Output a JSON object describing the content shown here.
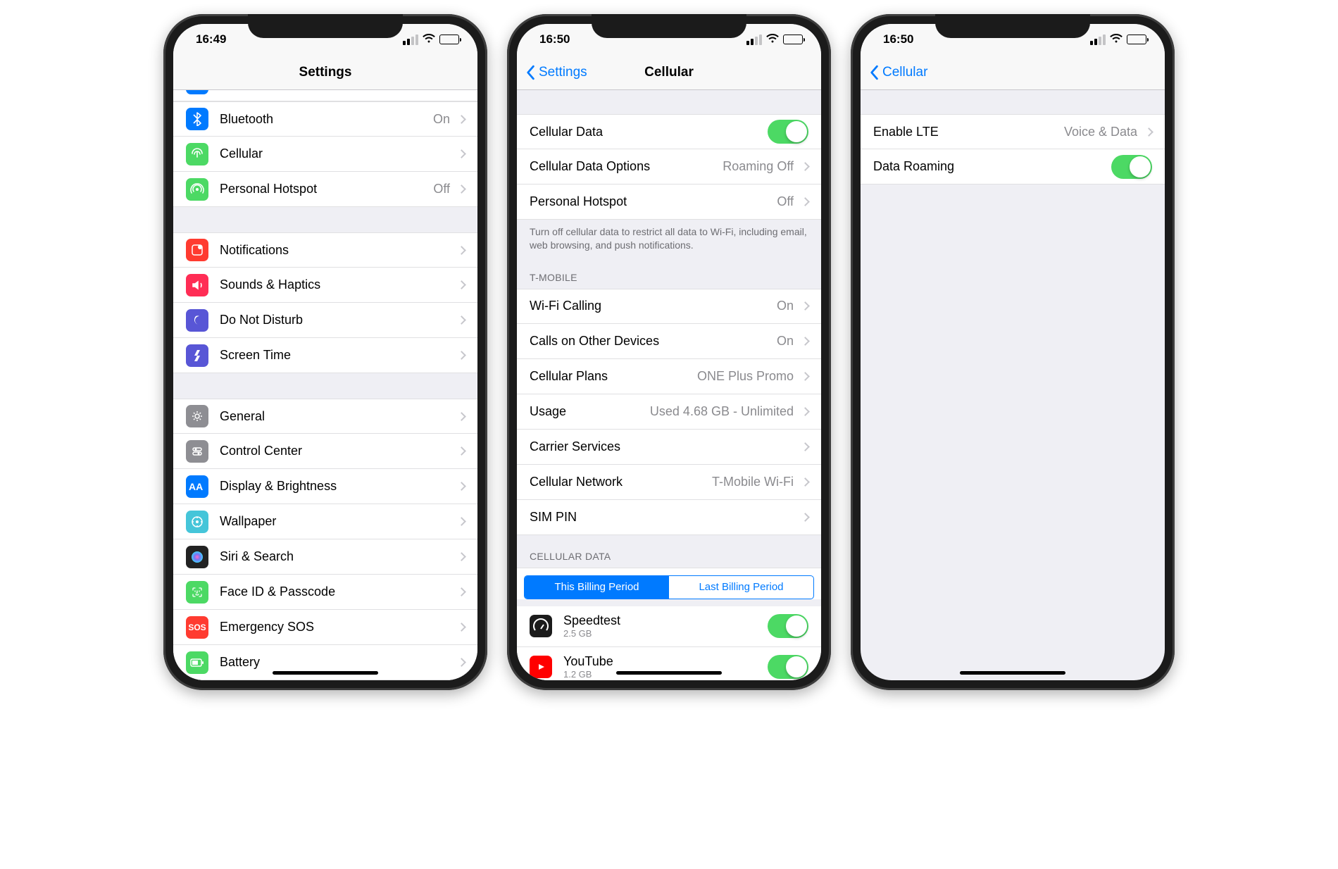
{
  "phone1": {
    "time": "16:49",
    "nav": {
      "title": "Settings"
    },
    "groups": [
      {
        "items": [
          {
            "icon": "bluetooth",
            "label": "Bluetooth",
            "value": "On",
            "bg": "#007aff"
          },
          {
            "icon": "cellular",
            "label": "Cellular",
            "bg": "#4cd964"
          },
          {
            "icon": "hotspot",
            "label": "Personal Hotspot",
            "value": "Off",
            "bg": "#4cd964"
          }
        ]
      },
      {
        "items": [
          {
            "icon": "notifications",
            "label": "Notifications",
            "bg": "#ff3b30"
          },
          {
            "icon": "sounds",
            "label": "Sounds & Haptics",
            "bg": "#ff2d55"
          },
          {
            "icon": "dnd",
            "label": "Do Not Disturb",
            "bg": "#5856d6"
          },
          {
            "icon": "screentime",
            "label": "Screen Time",
            "bg": "#5856d6"
          }
        ]
      },
      {
        "items": [
          {
            "icon": "general",
            "label": "General",
            "bg": "#8e8e93"
          },
          {
            "icon": "control",
            "label": "Control Center",
            "bg": "#8e8e93"
          },
          {
            "icon": "display",
            "label": "Display & Brightness",
            "bg": "#007aff"
          },
          {
            "icon": "wallpaper",
            "label": "Wallpaper",
            "bg": "#45c5d9"
          },
          {
            "icon": "siri",
            "label": "Siri & Search",
            "bg": "#222"
          },
          {
            "icon": "faceid",
            "label": "Face ID & Passcode",
            "bg": "#4cd964"
          },
          {
            "icon": "sos",
            "label": "Emergency SOS",
            "bg": "#ff3b30",
            "sos": true
          },
          {
            "icon": "battery",
            "label": "Battery",
            "bg": "#4cd964"
          }
        ]
      }
    ]
  },
  "phone2": {
    "time": "16:50",
    "nav": {
      "back": "Settings",
      "title": "Cellular"
    },
    "g1": [
      {
        "label": "Cellular Data",
        "toggle": true
      },
      {
        "label": "Cellular Data Options",
        "value": "Roaming Off",
        "chevron": true
      },
      {
        "label": "Personal Hotspot",
        "value": "Off",
        "chevron": true
      }
    ],
    "g1_footer": "Turn off cellular data to restrict all data to Wi-Fi, including email, web browsing, and push notifications.",
    "g2_header": "T-MOBILE",
    "g2": [
      {
        "label": "Wi-Fi Calling",
        "value": "On",
        "chevron": true
      },
      {
        "label": "Calls on Other Devices",
        "value": "On",
        "chevron": true
      },
      {
        "label": "Cellular Plans",
        "value": "ONE Plus Promo",
        "chevron": true
      },
      {
        "label": "Usage",
        "value": "Used 4.68 GB - Unlimited",
        "chevron": true
      },
      {
        "label": "Carrier Services",
        "chevron": true
      },
      {
        "label": "Cellular Network",
        "value": "T-Mobile Wi-Fi",
        "chevron": true
      },
      {
        "label": "SIM PIN",
        "chevron": true
      }
    ],
    "g3_header": "CELLULAR DATA",
    "seg": {
      "a": "This Billing Period",
      "b": "Last Billing Period"
    },
    "apps": [
      {
        "name": "Speedtest",
        "sub": "2.5 GB",
        "bg": "#1b1b1b"
      },
      {
        "name": "YouTube",
        "sub": "1.2 GB",
        "bg": "#ff0000"
      }
    ]
  },
  "phone3": {
    "time": "16:50",
    "nav": {
      "back": "Cellular"
    },
    "items": [
      {
        "label": "Enable LTE",
        "value": "Voice & Data",
        "chevron": true
      },
      {
        "label": "Data Roaming",
        "toggle": true
      }
    ]
  }
}
